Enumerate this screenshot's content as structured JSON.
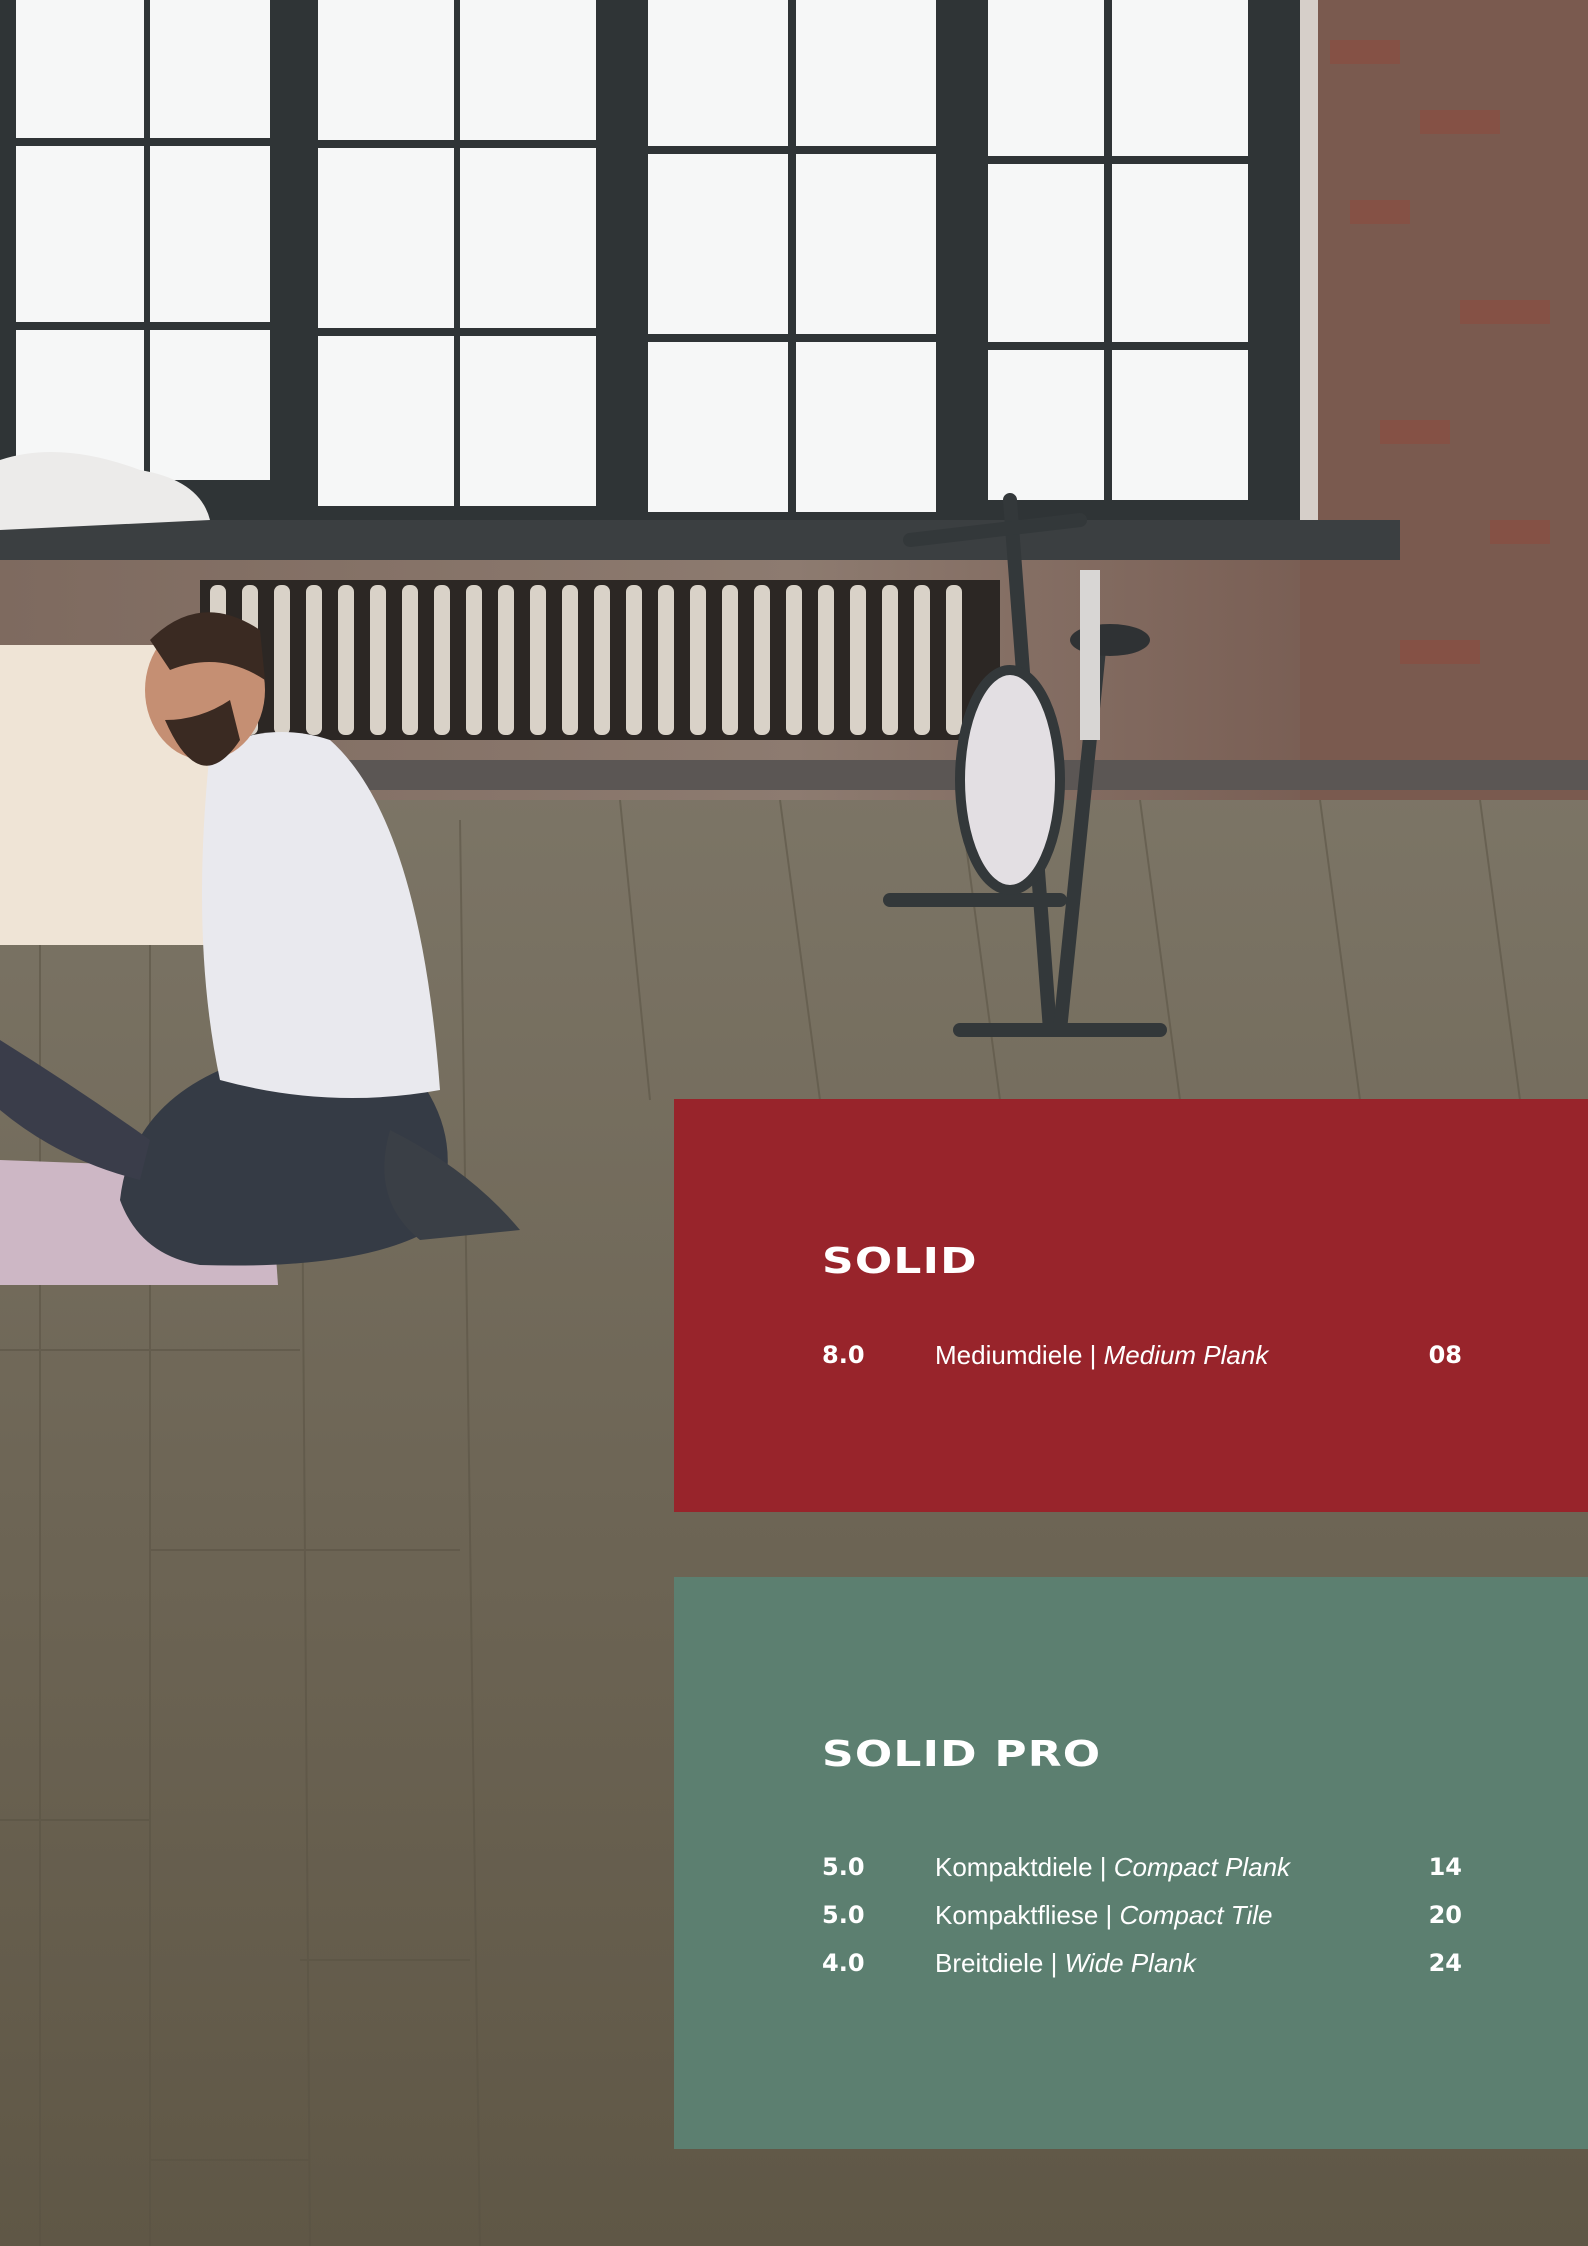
{
  "colors": {
    "solid_panel": "#98242b",
    "solid_pro_panel": "#5c7f70",
    "text": "#ffffff"
  },
  "solid": {
    "title": "SOLID",
    "rows": [
      {
        "thickness": "8.0",
        "name_de": "Mediumdiele",
        "separator": " | ",
        "name_en": "Medium Plank",
        "page": "08"
      }
    ]
  },
  "solid_pro": {
    "title": "SOLID PRO",
    "rows": [
      {
        "thickness": "5.0",
        "name_de": "Kompaktdiele",
        "separator": " | ",
        "name_en": "Compact Plank",
        "page": "14"
      },
      {
        "thickness": "5.0",
        "name_de": "Kompaktfliese",
        "separator": " | ",
        "name_en": "Compact Tile",
        "page": "20"
      },
      {
        "thickness": "4.0",
        "name_de": "Breitdiele",
        "separator": " | ",
        "name_en": "Wide Plank",
        "page": "24"
      }
    ]
  }
}
